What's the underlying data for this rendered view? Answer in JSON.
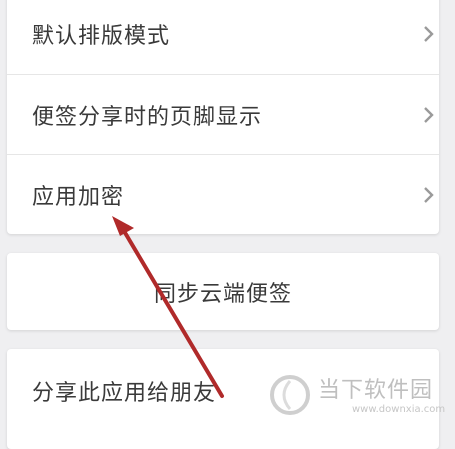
{
  "settings": {
    "items": [
      {
        "label": "默认排版模式"
      },
      {
        "label": "便签分享时的页脚显示"
      },
      {
        "label": "应用加密"
      }
    ]
  },
  "sync": {
    "label": "同步云端便签"
  },
  "share": {
    "label": "分享此应用给朋友"
  },
  "annotation": {
    "color": "#b02a2a"
  },
  "watermark": {
    "title": "当下软件园",
    "url": "www.downxia.com"
  }
}
